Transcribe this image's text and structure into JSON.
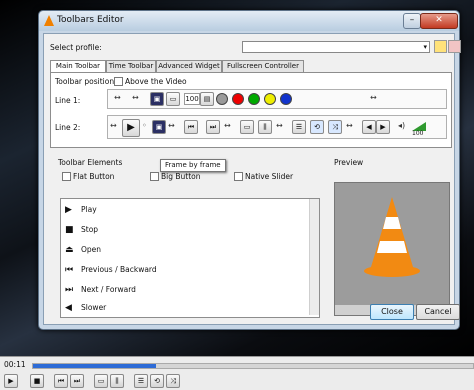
{
  "window": {
    "title": "Toolbars Editor",
    "minimize": "–",
    "close": "✕"
  },
  "profile": {
    "label": "Select profile:",
    "value": ""
  },
  "tabs": [
    {
      "label": "Main Toolbar",
      "active": true
    },
    {
      "label": "Time Toolbar",
      "active": false
    },
    {
      "label": "Advanced Widget",
      "active": false
    },
    {
      "label": "Fullscreen Controller",
      "active": false
    }
  ],
  "main_toolbar": {
    "position_label": "Toolbar position:",
    "above_video_label": "Above the Video",
    "above_video_checked": false,
    "line1_label": "Line 1:",
    "line2_label": "Line 2:",
    "spinner_value": "100",
    "volume_value": "100",
    "tooltip": "Frame by frame"
  },
  "elements": {
    "group_label": "Toolbar Elements",
    "flat_button": "Flat Button",
    "big_button": "Big Button",
    "native_slider": "Native Slider",
    "items": [
      {
        "icon": "▶",
        "label": "Play"
      },
      {
        "icon": "■",
        "label": "Stop"
      },
      {
        "icon": "⏏",
        "label": "Open"
      },
      {
        "icon": "⏮",
        "label": "Previous / Backward"
      },
      {
        "icon": "⏭",
        "label": "Next / Forward"
      },
      {
        "icon": "◀",
        "label": "Slower"
      }
    ]
  },
  "preview": {
    "label": "Preview"
  },
  "buttons": {
    "close": "Close",
    "cancel": "Cancel"
  },
  "player": {
    "time": "00:11",
    "progress": 0.28
  }
}
